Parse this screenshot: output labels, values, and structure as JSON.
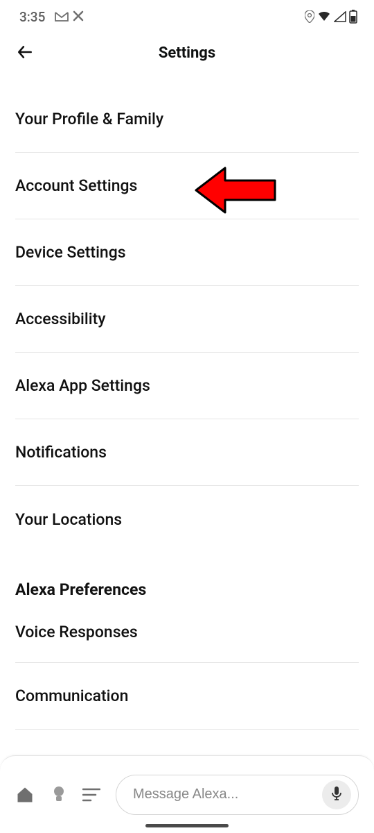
{
  "statusbar": {
    "time": "3:35"
  },
  "header": {
    "title": "Settings"
  },
  "settings": {
    "items": [
      {
        "label": "Your Profile & Family"
      },
      {
        "label": "Account Settings"
      },
      {
        "label": "Device Settings"
      },
      {
        "label": "Accessibility"
      },
      {
        "label": "Alexa App Settings"
      },
      {
        "label": "Notifications"
      },
      {
        "label": "Your Locations"
      }
    ]
  },
  "preferences": {
    "header": "Alexa Preferences",
    "items": [
      {
        "label": "Voice Responses"
      },
      {
        "label": "Communication"
      }
    ]
  },
  "footer": {
    "placeholder": "Message Alexa..."
  },
  "annotation": {
    "color": "#ff0000",
    "target": "Account Settings"
  }
}
